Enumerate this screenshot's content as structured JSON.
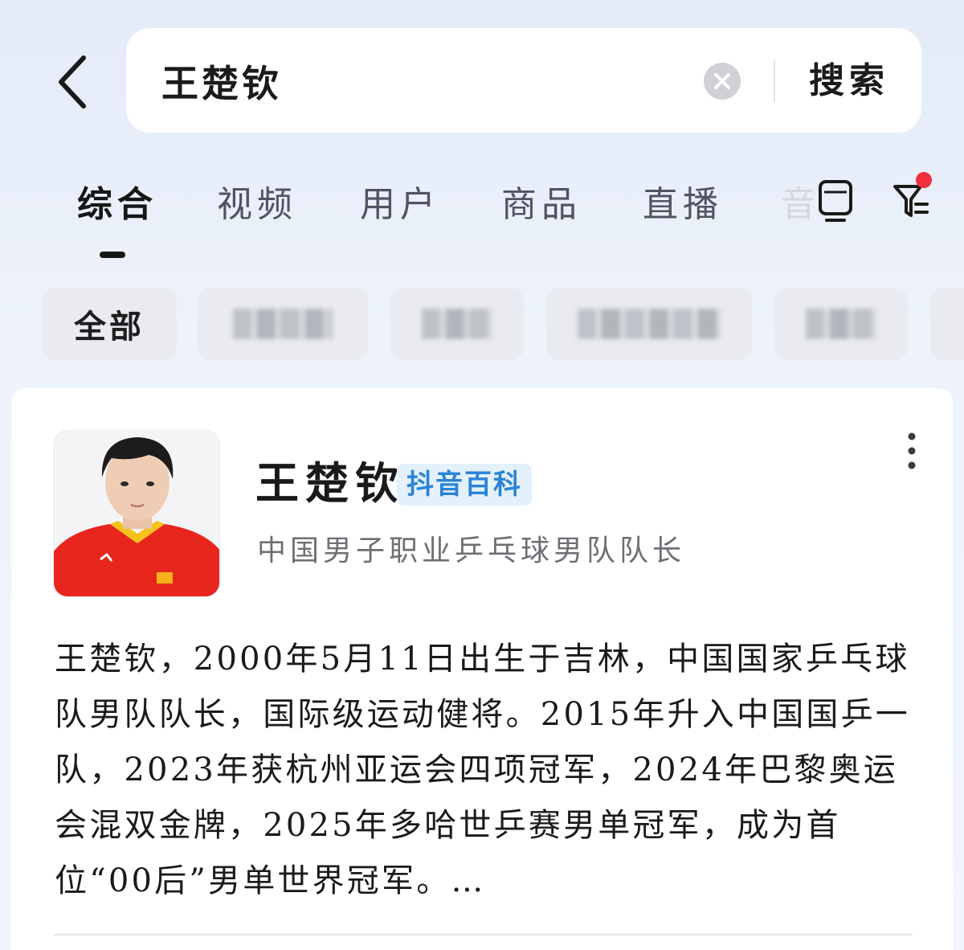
{
  "search": {
    "query": "王楚钦",
    "button_label": "搜索"
  },
  "tabs": [
    {
      "label": "综合",
      "active": true
    },
    {
      "label": "视频"
    },
    {
      "label": "用户"
    },
    {
      "label": "商品"
    },
    {
      "label": "直播"
    },
    {
      "label": "音"
    }
  ],
  "chips": [
    {
      "label": "全部",
      "active": true
    },
    {
      "label": ""
    },
    {
      "label": ""
    },
    {
      "label": ""
    },
    {
      "label": ""
    }
  ],
  "card": {
    "name": "王楚钦",
    "badge": "抖音百科",
    "subtitle": "中国男子职业乒乓球男队队长",
    "description": "王楚钦，2000年5月11日出生于吉林，中国国家乒乓球队男队队长，国际级运动健将。2015年升入中国国乒一队，2023年获杭州亚运会四项冠军，2024年巴黎奥运会混双金牌，2025年多哈世乒赛男单冠军，成为首位“00后”男单世界冠军。…"
  },
  "colors": {
    "accent": "#2b84d6",
    "badge_bg": "#e4f0fb",
    "notification_dot": "#f0303f",
    "jersey_red": "#e8261d"
  },
  "icons": {
    "back": "chevron-left-icon",
    "clear": "clear-circle-icon",
    "tv": "tv-icon",
    "filter": "filter-icon",
    "more": "more-vertical-icon"
  }
}
